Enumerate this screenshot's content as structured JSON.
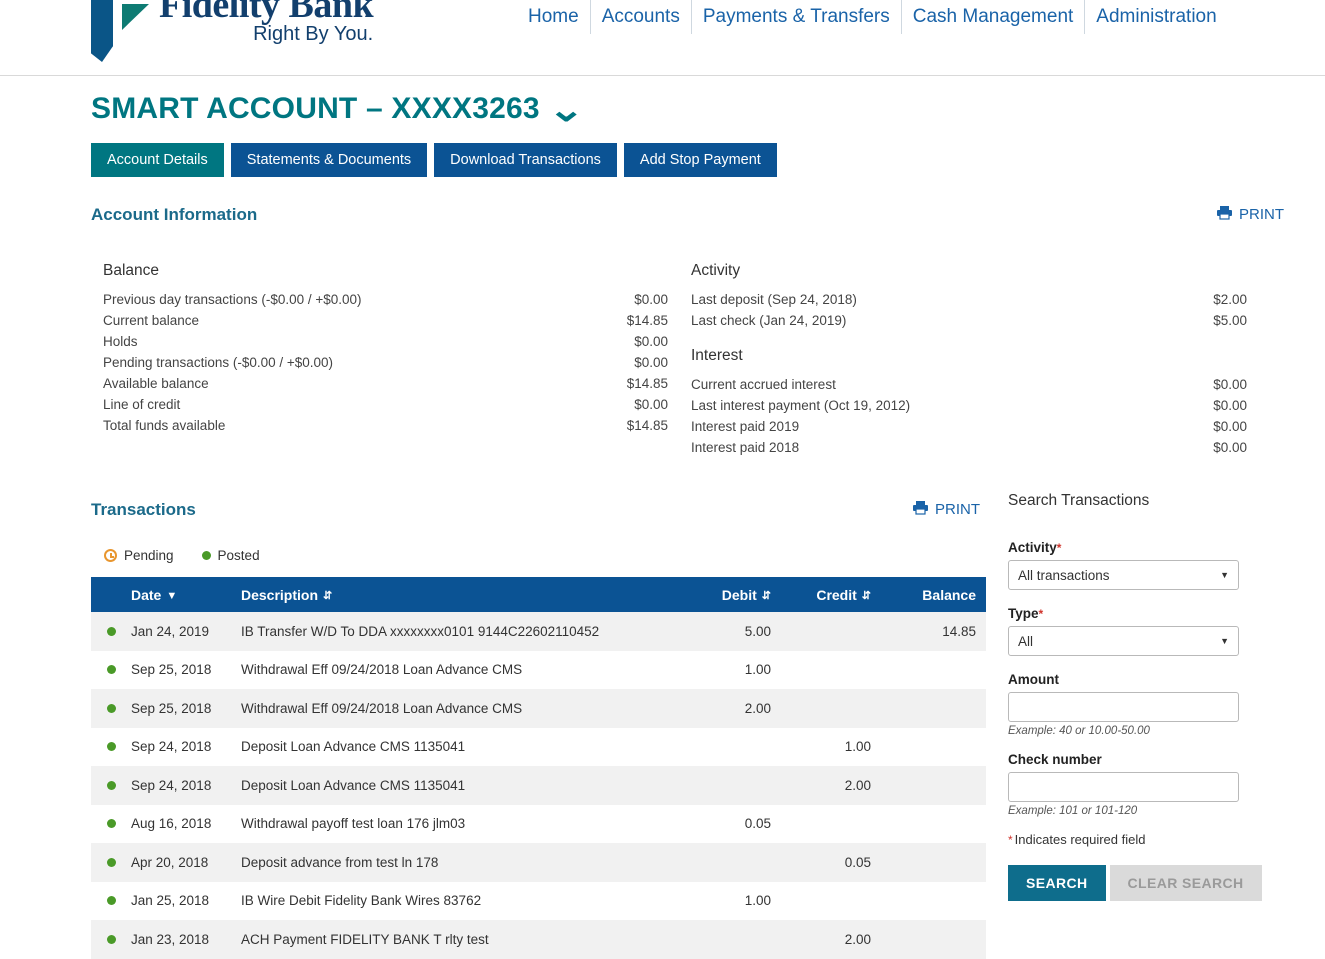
{
  "brand": {
    "name": "Fidelity Bank",
    "tagline": "Right By You.",
    "logo_blue": "#0a5587",
    "logo_teal": "#0e7b73"
  },
  "nav": {
    "items": [
      {
        "label": "Home"
      },
      {
        "label": "Accounts"
      },
      {
        "label": "Payments & Transfers"
      },
      {
        "label": "Cash Management"
      },
      {
        "label": "Administration"
      }
    ]
  },
  "page": {
    "title": "SMART ACCOUNT – XXXX3263",
    "title_caret": "chevron-down-icon",
    "title_color": "#007681"
  },
  "tabs": [
    {
      "label": "Account Details",
      "active": true
    },
    {
      "label": "Statements & Documents",
      "active": false
    },
    {
      "label": "Download Transactions",
      "active": false
    },
    {
      "label": "Add Stop Payment",
      "active": false
    }
  ],
  "account_information": {
    "heading": "Account Information",
    "print_label": "PRINT",
    "balance": {
      "group_title": "Balance",
      "rows": [
        {
          "label": "Previous day transactions (-$0.00 / +$0.00)",
          "value": "$0.00"
        },
        {
          "label": "Current balance",
          "value": "$14.85"
        },
        {
          "label": "Holds",
          "value": "$0.00"
        },
        {
          "label": "Pending transactions (-$0.00 / +$0.00)",
          "value": "$0.00"
        },
        {
          "label": "Available balance",
          "value": "$14.85"
        },
        {
          "label": "Line of credit",
          "value": "$0.00"
        },
        {
          "label": "Total funds available",
          "value": "$14.85"
        }
      ]
    },
    "activity": {
      "group_title": "Activity",
      "rows": [
        {
          "label": "Last deposit (Sep 24, 2018)",
          "value": "$2.00"
        },
        {
          "label": "Last check (Jan 24, 2019)",
          "value": "$5.00"
        }
      ]
    },
    "interest": {
      "group_title": "Interest",
      "rows": [
        {
          "label": "Current accrued interest",
          "value": "$0.00"
        },
        {
          "label": "Last interest payment (Oct 19, 2012)",
          "value": "$0.00"
        },
        {
          "label": "Interest paid 2019",
          "value": "$0.00"
        },
        {
          "label": "Interest paid 2018",
          "value": "$0.00"
        }
      ]
    }
  },
  "transactions": {
    "heading": "Transactions",
    "print_label": "PRINT",
    "legend": [
      {
        "label": "Pending",
        "icon": "clock-icon",
        "color": "#e8962f"
      },
      {
        "label": "Posted",
        "icon": "dot-icon",
        "color": "#4a9a28"
      }
    ],
    "columns": [
      {
        "key": "status",
        "label": ""
      },
      {
        "key": "date",
        "label": "Date",
        "sort": "descending"
      },
      {
        "key": "description",
        "label": "Description",
        "sort": "sortable"
      },
      {
        "key": "debit",
        "label": "Debit",
        "sort": "sortable"
      },
      {
        "key": "credit",
        "label": "Credit",
        "sort": "sortable"
      },
      {
        "key": "balance",
        "label": "Balance",
        "sort": "none"
      }
    ],
    "rows": [
      {
        "status": "posted",
        "date": "Jan 24, 2019",
        "description": "IB Transfer W/D To DDA xxxxxxxx0101 9144C22602110452",
        "debit": "5.00",
        "credit": "",
        "balance": "14.85"
      },
      {
        "status": "posted",
        "date": "Sep 25, 2018",
        "description": "Withdrawal Eff 09/24/2018 Loan Advance CMS",
        "debit": "1.00",
        "credit": "",
        "balance": ""
      },
      {
        "status": "posted",
        "date": "Sep 25, 2018",
        "description": "Withdrawal Eff 09/24/2018 Loan Advance CMS",
        "debit": "2.00",
        "credit": "",
        "balance": ""
      },
      {
        "status": "posted",
        "date": "Sep 24, 2018",
        "description": "Deposit Loan Advance CMS 1135041",
        "debit": "",
        "credit": "1.00",
        "balance": ""
      },
      {
        "status": "posted",
        "date": "Sep 24, 2018",
        "description": "Deposit Loan Advance CMS 1135041",
        "debit": "",
        "credit": "2.00",
        "balance": ""
      },
      {
        "status": "posted",
        "date": "Aug 16, 2018",
        "description": "Withdrawal payoff test loan 176 jlm03",
        "debit": "0.05",
        "credit": "",
        "balance": ""
      },
      {
        "status": "posted",
        "date": "Apr 20, 2018",
        "description": "Deposit advance from test ln 178",
        "debit": "",
        "credit": "0.05",
        "balance": ""
      },
      {
        "status": "posted",
        "date": "Jan 25, 2018",
        "description": "IB Wire Debit Fidelity Bank Wires 83762",
        "debit": "1.00",
        "credit": "",
        "balance": ""
      },
      {
        "status": "posted",
        "date": "Jan 23, 2018",
        "description": "ACH Payment FIDELITY BANK T rlty test",
        "debit": "",
        "credit": "2.00",
        "balance": ""
      }
    ]
  },
  "search": {
    "title": "Search Transactions",
    "activity": {
      "label": "Activity",
      "required": true,
      "value": "All transactions"
    },
    "type": {
      "label": "Type",
      "required": true,
      "value": "All"
    },
    "amount": {
      "label": "Amount",
      "value": "",
      "placeholder": "",
      "hint": "Example: 40 or 10.00-50.00"
    },
    "check_number": {
      "label": "Check number",
      "value": "",
      "placeholder": "",
      "hint": "Example: 101 or 101-120"
    },
    "required_note": "Indicates required field",
    "required_marker": "*",
    "search_button": "SEARCH",
    "clear_button": "CLEAR SEARCH"
  }
}
